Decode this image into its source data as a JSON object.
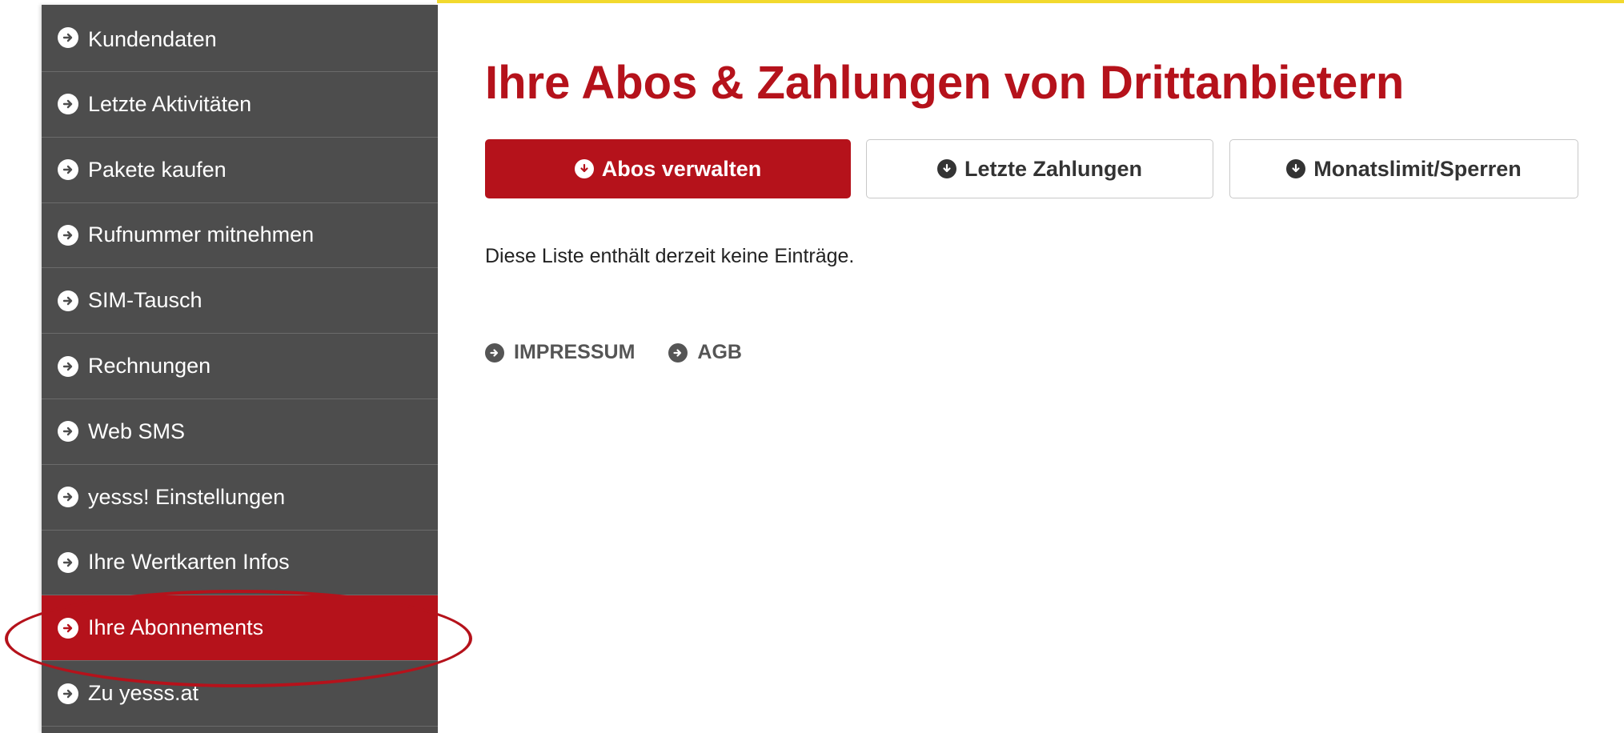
{
  "sidebar": {
    "items": [
      {
        "label": "Kundendaten"
      },
      {
        "label": "Letzte Aktivitäten"
      },
      {
        "label": "Pakete kaufen"
      },
      {
        "label": "Rufnummer mitnehmen"
      },
      {
        "label": "SIM-Tausch"
      },
      {
        "label": "Rechnungen"
      },
      {
        "label": "Web SMS"
      },
      {
        "label": "yesss! Einstellungen"
      },
      {
        "label": "Ihre Wertkarten Infos"
      },
      {
        "label": "Ihre Abonnements"
      },
      {
        "label": "Zu yesss.at"
      }
    ],
    "active_label": "Ihre Abonnements"
  },
  "main": {
    "title": "Ihre Abos & Zahlungen von Drittanbietern",
    "tabs": [
      {
        "label": "Abos verwalten",
        "active": true
      },
      {
        "label": "Letzte Zahlungen",
        "active": false
      },
      {
        "label": "Monatslimit/Sperren",
        "active": false
      }
    ],
    "empty_message": "Diese Liste enthält derzeit keine Einträge."
  },
  "footer": {
    "links": [
      {
        "label": "IMPRESSUM"
      },
      {
        "label": "AGB"
      }
    ]
  },
  "colors": {
    "brand_red": "#b5121b",
    "sidebar_bg": "#4d4d4d",
    "top_accent": "#f2d92e"
  },
  "icons": {
    "nav_item": "arrow-right-circle-icon",
    "tab": "arrow-down-circle-icon",
    "footer_link": "arrow-right-circle-icon"
  }
}
